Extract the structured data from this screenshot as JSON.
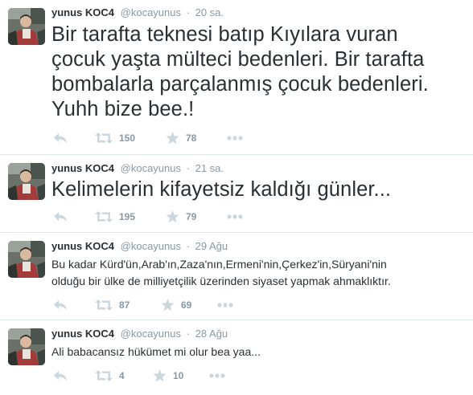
{
  "tweets": [
    {
      "fullname": "yunus KOC4",
      "username": "@kocayunus",
      "dot": "·",
      "time": "20 sa.",
      "lines": [
        "Bir tarafta teknesi batıp Kıyılara vuran",
        "çocuk yaşta mülteci bedenleri. Bir tarafta",
        "bombalarla parçalanmış çocuk bedenleri.",
        "Yuhh bize bee.!"
      ],
      "retweets": "150",
      "favorites": "78"
    },
    {
      "fullname": "yunus KOC4",
      "username": "@kocayunus",
      "dot": "·",
      "time": "21 sa.",
      "lines": [
        "Kelimelerin kifayetsiz kaldığı günler..."
      ],
      "retweets": "195",
      "favorites": "79"
    },
    {
      "fullname": "yunus KOC4",
      "username": "@kocayunus",
      "dot": "·",
      "time": "29 Ağu",
      "lines": [
        "Bu kadar Kürd'ün,Arab'ın,Zaza'nın,Ermeni'nin,Çerkez'in,Süryani'nin",
        "olduğu bir ülke de milliyetçilik üzerinden siyaset yapmak ahmaklıktır."
      ],
      "retweets": "87",
      "favorites": "69"
    },
    {
      "fullname": "yunus KOC4",
      "username": "@kocayunus",
      "dot": "·",
      "time": "28 Ağu",
      "lines": [
        "Ali babacansız hükümet mi olur bea yaa..."
      ],
      "retweets": "4",
      "favorites": "10"
    }
  ],
  "icons": {
    "reply": "reply-icon",
    "retweet": "retweet-icon",
    "favorite": "star-icon",
    "more": "more-icon"
  },
  "colors": {
    "icon": "#ccd6dd",
    "count": "#8899a6",
    "name": "#292f33",
    "meta": "#8899a6",
    "divider": "#e1e8ed"
  }
}
